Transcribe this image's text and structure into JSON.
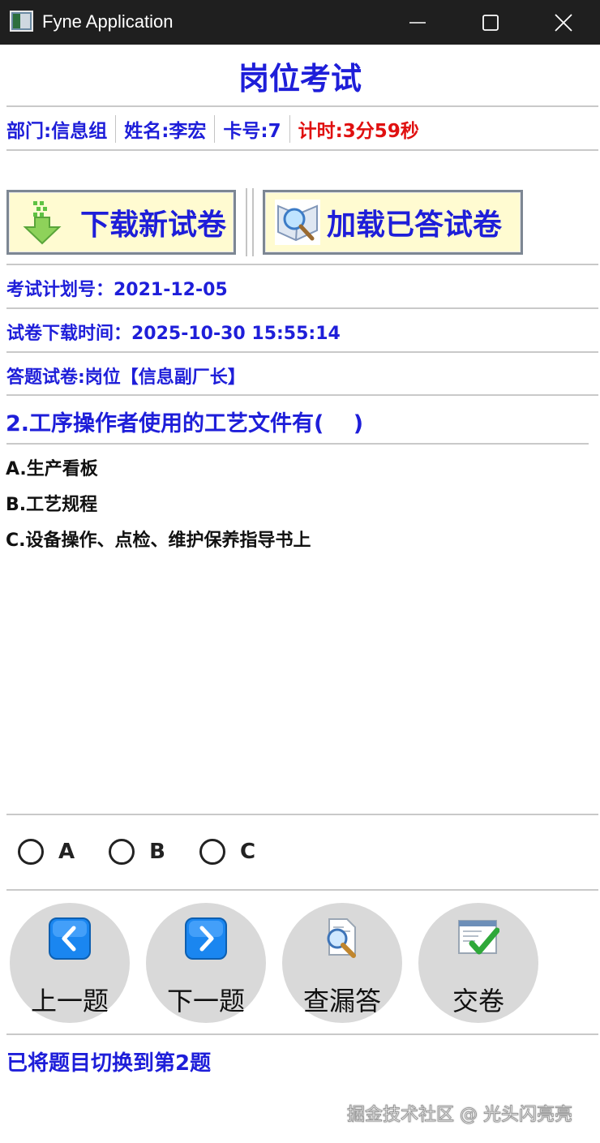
{
  "window": {
    "title": "Fyne Application"
  },
  "header": {
    "title": "岗位考试",
    "department": "部门:信息组",
    "name": "姓名:李宏",
    "card": "卡号:7",
    "timer": "计时:3分59秒"
  },
  "actions": {
    "download_label": "下载新试卷",
    "load_label": "加载已答试卷"
  },
  "exam": {
    "plan": "考试计划号：2021-12-05",
    "download_time": "试卷下载时间：2025-10-30 15:55:14",
    "paper": "答题试卷:岗位【信息副厂长】"
  },
  "question": {
    "text": "2.工序操作者使用的工艺文件有(　 )",
    "options": [
      "A.生产看板",
      "B.工艺规程",
      "C.设备操作、点检、维护保养指导书上"
    ]
  },
  "answers": {
    "choices": [
      "A",
      "B",
      "C"
    ],
    "selected": null
  },
  "nav": {
    "prev_label": "上一题",
    "next_label": "下一题",
    "check_label": "查漏答",
    "submit_label": "交卷"
  },
  "status": "已将题目切换到第2题",
  "watermark": "掘金技术社区 @ 光头闪亮亮",
  "colors": {
    "accent": "#1e1ed9",
    "timer": "#e01010",
    "button_bg": "#fffbd1",
    "round_button_bg": "#d9d9d9"
  }
}
